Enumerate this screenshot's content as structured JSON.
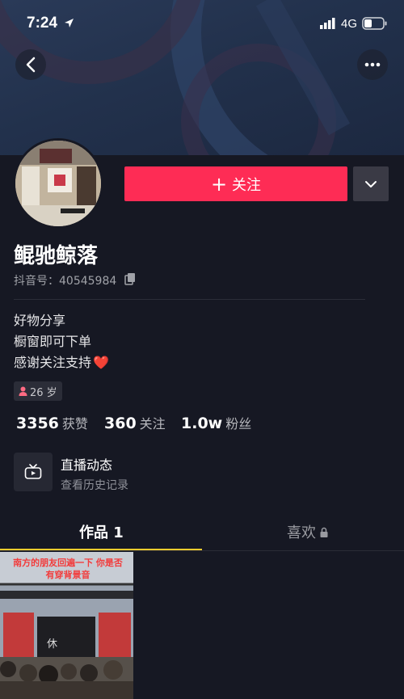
{
  "status_bar": {
    "time": "7:24",
    "network": "4G"
  },
  "profile": {
    "name": "鲲驰鲸落",
    "douyin_id": "抖音号：40545984",
    "bio": [
      "好物分享",
      "橱窗即可下单",
      "感谢关注支持"
    ],
    "bio_emoji": "❤️",
    "age": "26 岁"
  },
  "actions": {
    "follow_label": "关注",
    "follow_plus": "+"
  },
  "stats": [
    {
      "value": "3356",
      "label": "获赞"
    },
    {
      "value": "360",
      "label": "关注"
    },
    {
      "value": "1.0w",
      "label": "粉丝"
    }
  ],
  "live": {
    "title": "直播动态",
    "subtitle": "查看历史记录"
  },
  "tabs": [
    {
      "label": "作品 1"
    },
    {
      "label": "喜欢"
    }
  ],
  "video": {
    "caption": "南方的朋友回遍一下 你是否有穿背景音"
  },
  "colors": {
    "accent": "#fe2c55",
    "tab_indicator": "#facc2e",
    "background": "#161823"
  }
}
